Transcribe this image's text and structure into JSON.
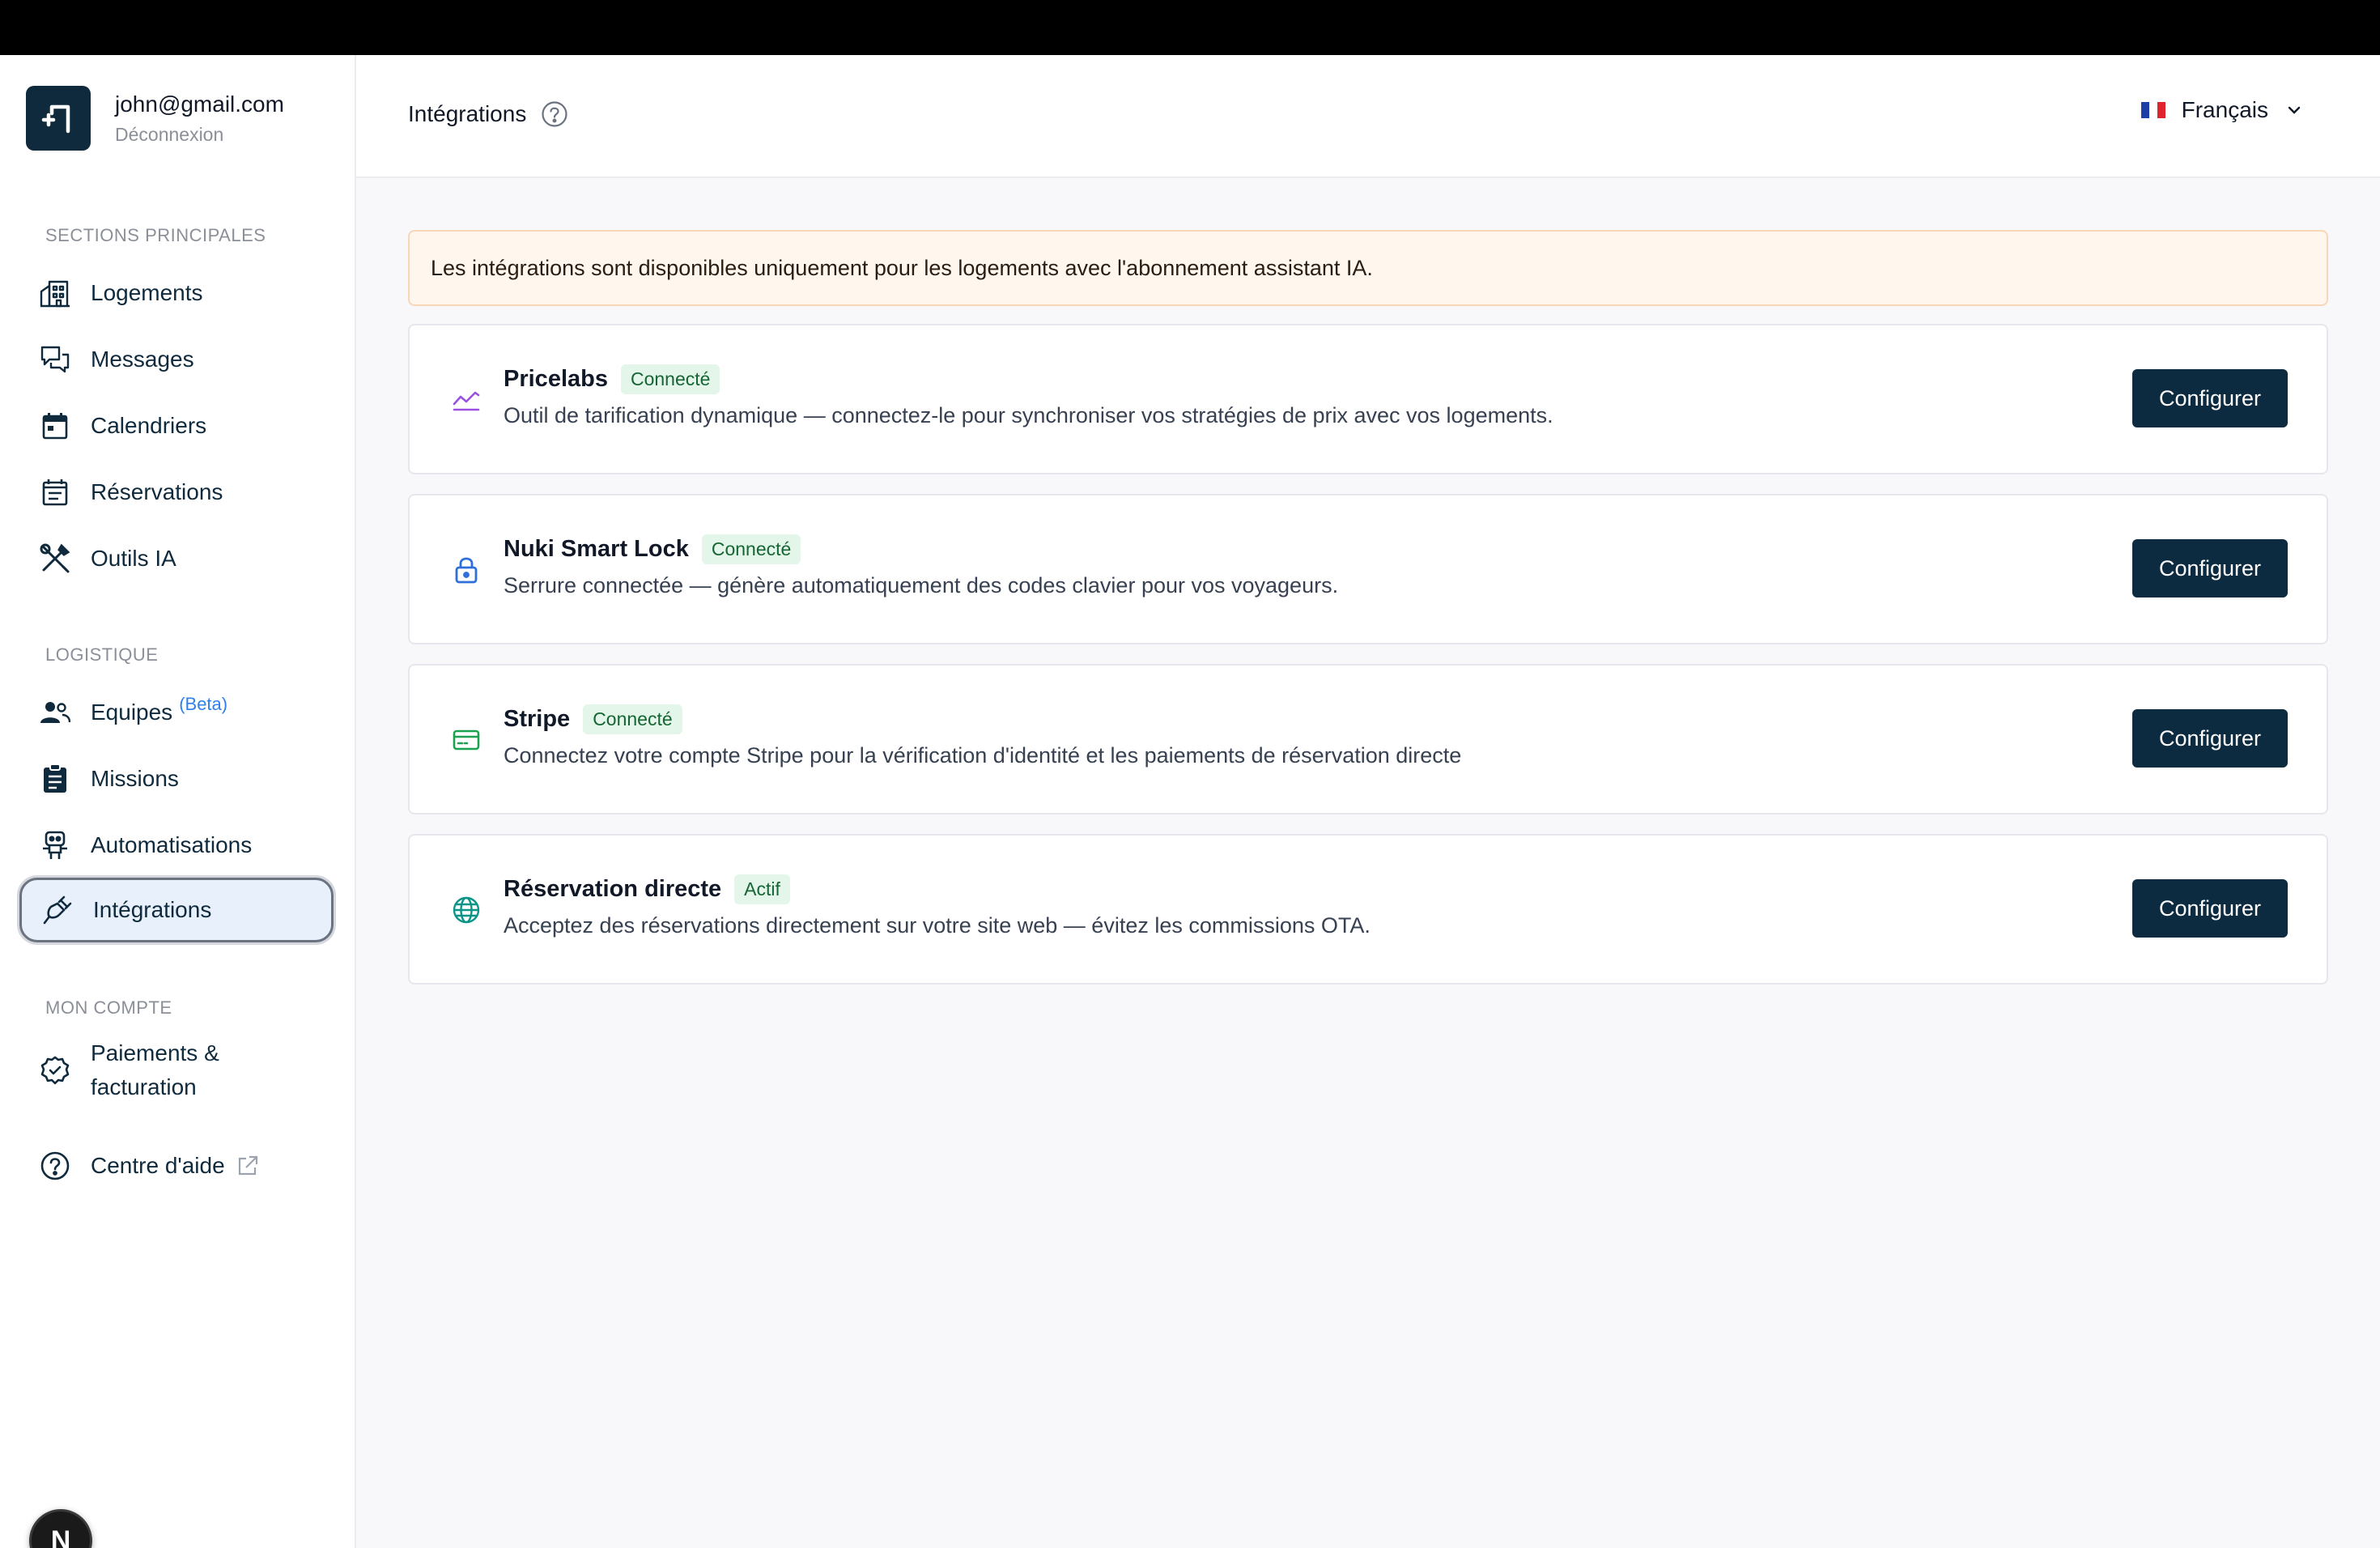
{
  "user": {
    "email": "john@gmail.com",
    "logout_label": "Déconnexion"
  },
  "sections": {
    "main": "SECTIONS PRINCIPALES",
    "logistics": "LOGISTIQUE",
    "account": "MON COMPTE"
  },
  "nav": {
    "logements": "Logements",
    "messages": "Messages",
    "calendriers": "Calendriers",
    "reservations": "Réservations",
    "outils_ia": "Outils IA",
    "equipes": "Equipes",
    "equipes_badge": "(Beta)",
    "missions": "Missions",
    "automatisations": "Automatisations",
    "integrations": "Intégrations",
    "paiements_line1": "Paiements &",
    "paiements_line2": "facturation",
    "aide": "Centre d'aide"
  },
  "header": {
    "title": "Intégrations",
    "language": "Français"
  },
  "banner": "Les intégrations sont disponibles uniquement pour les logements avec l'abonnement assistant IA.",
  "integrations": [
    {
      "name": "Pricelabs",
      "status": "Connecté",
      "description": "Outil de tarification dynamique — connectez-le pour synchroniser vos stratégies de prix avec vos logements.",
      "button": "Configurer",
      "icon": "chart-line-icon",
      "icon_color": "#9b51e0"
    },
    {
      "name": "Nuki Smart Lock",
      "status": "Connecté",
      "description": "Serrure connectée — génère automatiquement des codes clavier pour vos voyageurs.",
      "button": "Configurer",
      "icon": "lock-icon",
      "icon_color": "#2f6fdb"
    },
    {
      "name": "Stripe",
      "status": "Connecté",
      "description": "Connectez votre compte Stripe pour la vérification d'identité et les paiements de réservation directe",
      "button": "Configurer",
      "icon": "card-icon",
      "icon_color": "#1aa251"
    },
    {
      "name": "Réservation directe",
      "status": "Actif",
      "description": "Acceptez des réservations directement sur votre site web — évitez les commissions OTA.",
      "button": "Configurer",
      "icon": "globe-icon",
      "icon_color": "#0d9488"
    }
  ],
  "next_badge": "N",
  "colors": {
    "brand": "#0c2b40",
    "accent": "#2f80ed",
    "badge_bg": "#e3f6e9",
    "badge_text": "#166534"
  }
}
